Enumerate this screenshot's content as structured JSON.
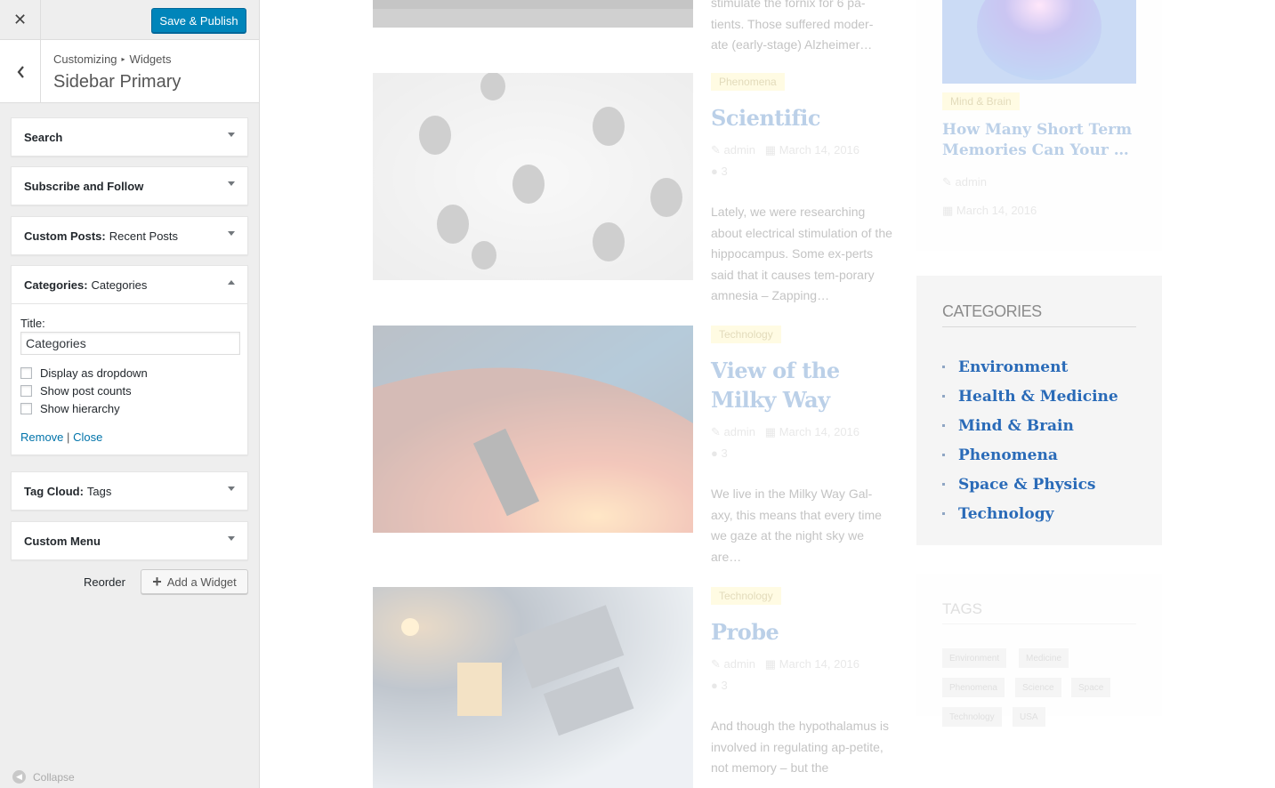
{
  "customizer": {
    "close_glyph": "✕",
    "publish_label": "Save & Publish",
    "back_glyph": "‹",
    "breadcrumb": {
      "root": "Customizing",
      "sep": "▸",
      "current": "Widgets"
    },
    "section_title": "Sidebar Primary",
    "widgets": [
      {
        "title": "Search",
        "subtitle": ""
      },
      {
        "title": "Subscribe and Follow",
        "subtitle": ""
      },
      {
        "title": "Custom Posts:",
        "subtitle": "Recent Posts"
      },
      {
        "title": "Categories:",
        "subtitle": "Categories"
      },
      {
        "title": "Tag Cloud:",
        "subtitle": "Tags"
      },
      {
        "title": "Custom Menu",
        "subtitle": ""
      }
    ],
    "open_widget": {
      "title_label": "Title:",
      "title_value": "Categories",
      "options": [
        "Display as dropdown",
        "Show post counts",
        "Show hierarchy"
      ],
      "remove_label": "Remove",
      "separator": "|",
      "close_label": "Close"
    },
    "reorder_label": "Reorder",
    "add_widget_label": "Add a Widget",
    "collapse_label": "Collapse"
  },
  "preview": {
    "top_excerpt": "stimulate the fornix for 6 pa-\ntients. Those suffered moder-\nate (early-stage) Alzheimer…",
    "posts": [
      {
        "category": "Phenomena",
        "title": "Scientific",
        "author": "admin",
        "date": "March 14, 2016",
        "comments": "3",
        "excerpt": "Lately, we were researching about electrical stimulation of the hippocampus. Some ex-perts said that it causes tem-porary amnesia – Zapping…"
      },
      {
        "category": "Technology",
        "title": "View of the Milky Way",
        "author": "admin",
        "date": "March 14, 2016",
        "comments": "3",
        "excerpt": "We live in the Milky Way Gal-axy, this means that every time we gaze at the night sky we are…"
      },
      {
        "category": "Technology",
        "title": "Probe",
        "author": "admin",
        "date": "March 14, 2016",
        "comments": "3",
        "excerpt": "And though the hypothalamus is involved in regulating ap-petite, not memory – but the"
      }
    ],
    "brain_card": {
      "category": "Mind & Brain",
      "title": "How Many Short Term Memories Can Your …",
      "author": "admin",
      "date": "March 14, 2016"
    },
    "categories_widget": {
      "heading": "CATEGORIES",
      "items": [
        "Environment",
        "Health & Medicine",
        "Mind & Brain",
        "Phenomena",
        "Space & Physics",
        "Technology"
      ]
    },
    "tags_widget": {
      "heading": "TAGS",
      "tags": [
        "Environment",
        "Medicine",
        "Phenomena",
        "Science",
        "Space",
        "Technology",
        "USA"
      ]
    }
  }
}
